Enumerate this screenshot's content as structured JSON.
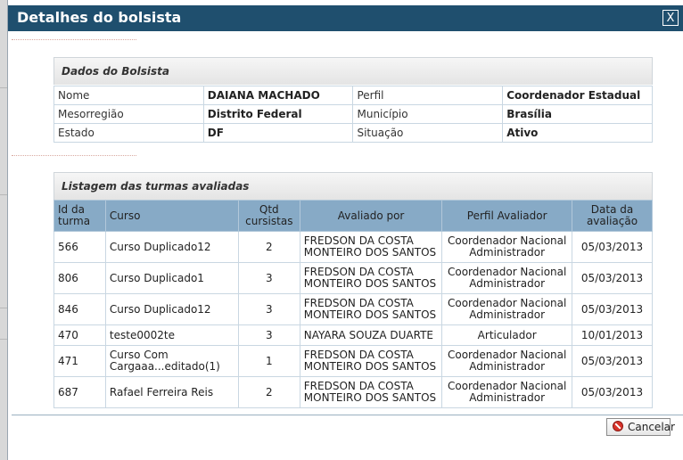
{
  "dialog": {
    "title": "Detalhes do bolsista",
    "close_label": "X",
    "cancel_label": "Cancelar"
  },
  "bolsista": {
    "section_title": "Dados do Bolsista",
    "rows": [
      {
        "label1": "Nome",
        "value1": "DAIANA MACHADO",
        "label2": "Perfil",
        "value2": "Coordenador Estadual"
      },
      {
        "label1": "Mesorregião",
        "value1": "Distrito Federal",
        "label2": "Município",
        "value2": "Brasília"
      },
      {
        "label1": "Estado",
        "value1": "DF",
        "label2": "Situação",
        "value2": "Ativo"
      }
    ]
  },
  "turmas": {
    "section_title": "Listagem das turmas avaliadas",
    "headers": [
      "Id da turma",
      "Curso",
      "Qtd cursistas",
      "Avaliado por",
      "Perfil Avaliador",
      "Data da avaliação"
    ],
    "rows": [
      {
        "id": "566",
        "curso": "Curso Duplicado12",
        "qtd": "2",
        "avaliado": "FREDSON DA COSTA MONTEIRO DOS SANTOS",
        "perfil": "Coordenador Nacional Administrador",
        "data": "05/03/2013"
      },
      {
        "id": "806",
        "curso": "Curso Duplicado1",
        "qtd": "3",
        "avaliado": "FREDSON DA COSTA MONTEIRO DOS SANTOS",
        "perfil": "Coordenador Nacional Administrador",
        "data": "05/03/2013"
      },
      {
        "id": "846",
        "curso": "Curso Duplicado12",
        "qtd": "3",
        "avaliado": "FREDSON DA COSTA MONTEIRO DOS SANTOS",
        "perfil": "Coordenador Nacional Administrador",
        "data": "05/03/2013"
      },
      {
        "id": "470",
        "curso": "teste0002te",
        "qtd": "3",
        "avaliado": "NAYARA SOUZA DUARTE",
        "perfil": "Articulador",
        "data": "10/01/2013"
      },
      {
        "id": "471",
        "curso": "Curso Com Cargaaa...editado(1)",
        "qtd": "1",
        "avaliado": "FREDSON DA COSTA MONTEIRO DOS SANTOS",
        "perfil": "Coordenador Nacional Administrador",
        "data": "05/03/2013"
      },
      {
        "id": "687",
        "curso": "Rafael Ferreira Reis",
        "qtd": "2",
        "avaliado": "FREDSON DA COSTA MONTEIRO DOS SANTOS",
        "perfil": "Coordenador Nacional Administrador",
        "data": "05/03/2013"
      }
    ]
  }
}
